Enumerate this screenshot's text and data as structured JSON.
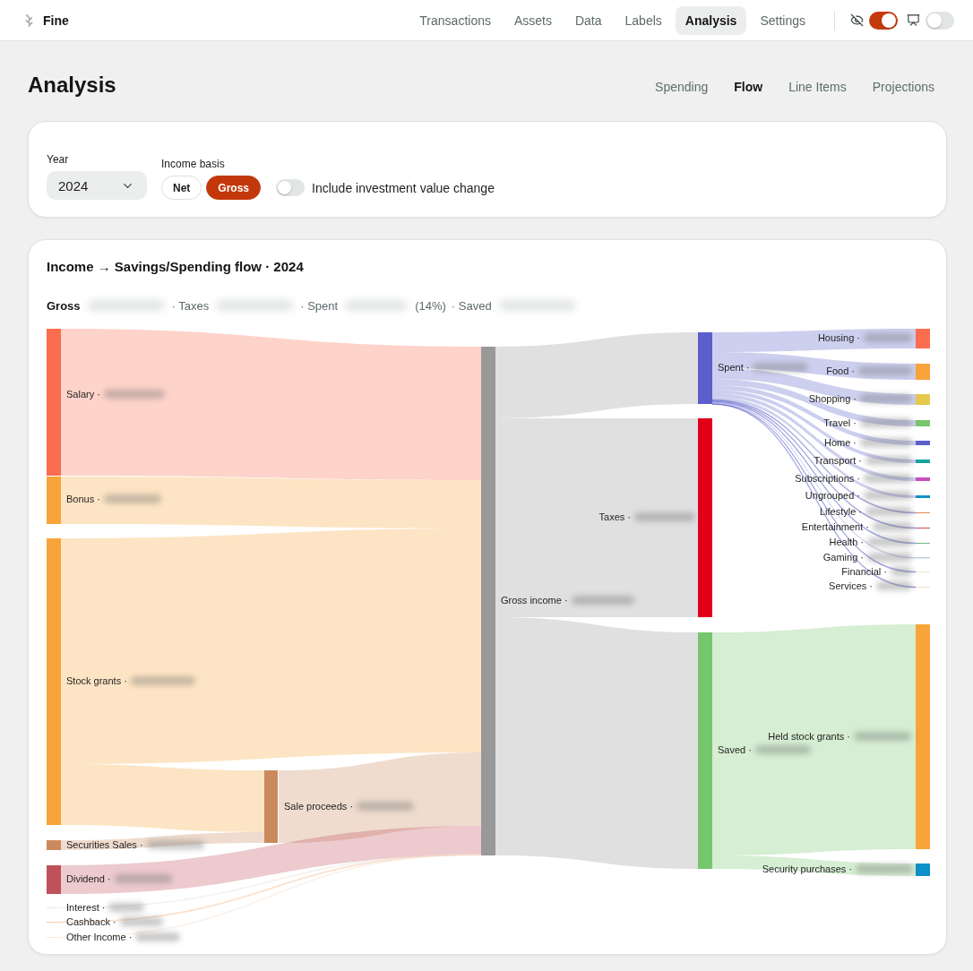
{
  "app": {
    "name": "Fine"
  },
  "nav": [
    {
      "label": "Transactions",
      "selected": false
    },
    {
      "label": "Assets",
      "selected": false
    },
    {
      "label": "Data",
      "selected": false
    },
    {
      "label": "Labels",
      "selected": false
    },
    {
      "label": "Analysis",
      "selected": true
    },
    {
      "label": "Settings",
      "selected": false
    }
  ],
  "toggles": [
    {
      "kind": "privacy",
      "on": true
    },
    {
      "kind": "presentation",
      "on": false
    }
  ],
  "page": {
    "title": "Analysis",
    "tabs": [
      {
        "label": "Spending",
        "selected": false
      },
      {
        "label": "Flow",
        "selected": true
      },
      {
        "label": "Line Items",
        "selected": false
      },
      {
        "label": "Projections",
        "selected": false
      }
    ]
  },
  "filters": {
    "year": {
      "label": "Year",
      "value": "2024"
    },
    "income_basis": {
      "label": "Income basis",
      "options": [
        {
          "label": "Net",
          "selected": false
        },
        {
          "label": "Gross",
          "selected": true
        }
      ]
    },
    "investment_change": {
      "label": "Include investment value change",
      "on": false
    }
  },
  "flow": {
    "title": "Income → Savings/Spending flow · 2024",
    "summary": [
      {
        "kind": "total",
        "label": "Gross"
      },
      {
        "kind": "part",
        "label": "· Taxes"
      },
      {
        "kind": "part",
        "label": "· Spent",
        "note": "(14%)"
      },
      {
        "kind": "part",
        "label": "· Saved"
      }
    ],
    "nodes": [
      {
        "label": "Salary ·",
        "color": "#fb6d4f"
      },
      {
        "label": "Bonus ·",
        "color": "#f8a43a"
      },
      {
        "label": "Stock grants ·",
        "color": "#f8a43a"
      },
      {
        "label": "Securities Sales ·",
        "color": "#cb8a5c"
      },
      {
        "label": "Dividend ·",
        "color": "#bf515a"
      },
      {
        "label": "Interest ·",
        "color": "#f1e6df"
      },
      {
        "label": "Cashback ·",
        "color": "#f4c8a6"
      },
      {
        "label": "Other Income ·",
        "color": "#f8e6da"
      },
      {
        "label": "Sale proceeds ·",
        "color": "#cb8a5c"
      },
      {
        "label": "Gross income ·",
        "color": "#999999"
      },
      {
        "label": "Spent ·",
        "color": "#5b5fcb"
      },
      {
        "label": "Taxes ·",
        "color": "#e1001a"
      },
      {
        "label": "Saved ·",
        "color": "#76c66d"
      },
      {
        "label": "Housing ·",
        "color": "#fb6d4f"
      },
      {
        "label": "Food ·",
        "color": "#f8a43a"
      },
      {
        "label": "Shopping ·",
        "color": "#e5c94d"
      },
      {
        "label": "Travel ·",
        "color": "#76c66d"
      },
      {
        "label": "Home ·",
        "color": "#5b5fcb"
      },
      {
        "label": "Transport ·",
        "color": "#17a39b"
      },
      {
        "label": "Subscriptions ·",
        "color": "#c94fc1"
      },
      {
        "label": "Ungrouped ·",
        "color": "#0e91c9"
      },
      {
        "label": "Lifestyle ·",
        "color": "#e38a4b"
      },
      {
        "label": "Entertainment ·",
        "color": "#c15059"
      },
      {
        "label": "Health ·",
        "color": "#6bb58b"
      },
      {
        "label": "Gaming ·",
        "color": "#bdd0e5"
      },
      {
        "label": "Financial ·",
        "color": "#f8e3cb"
      },
      {
        "label": "Services ·",
        "color": "#f5d8d8"
      },
      {
        "label": "Held stock grants ·",
        "color": "#f8a43a"
      },
      {
        "label": "Security purchases ·",
        "color": "#0e91c9"
      }
    ]
  }
}
